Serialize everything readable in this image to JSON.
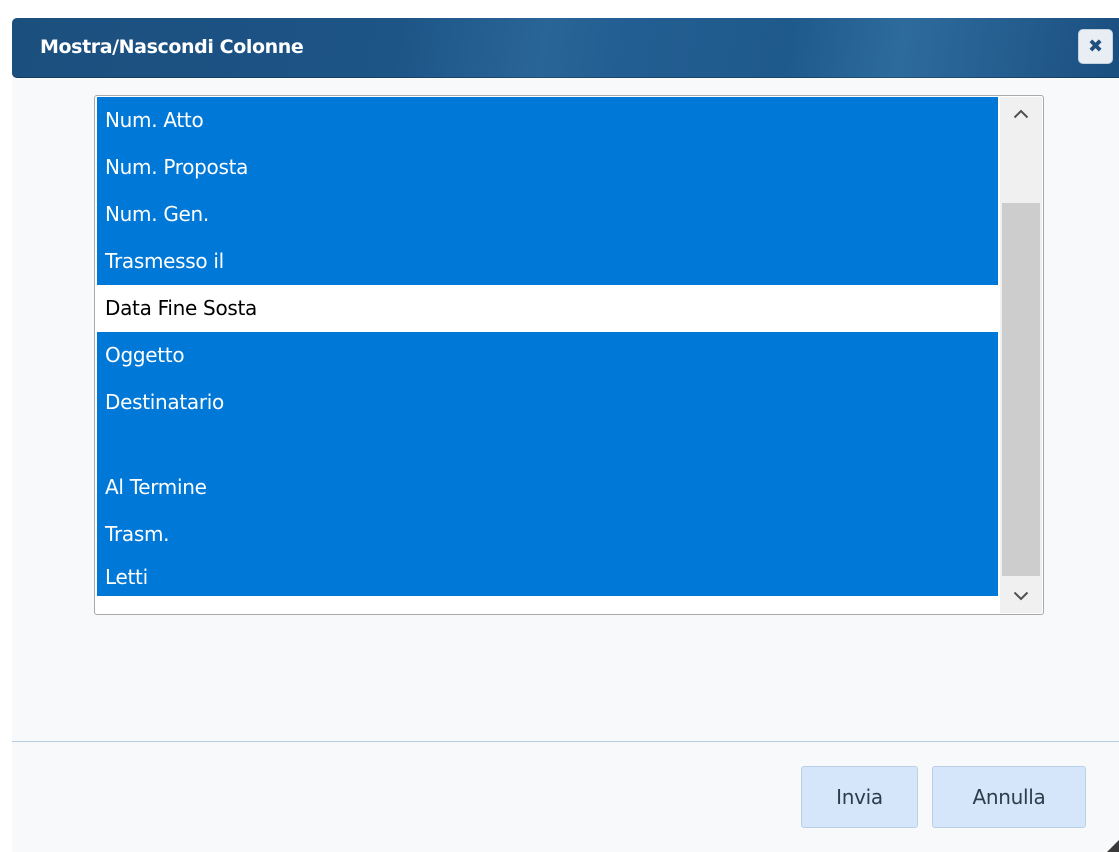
{
  "dialog": {
    "title": "Mostra/Nascondi Colonne",
    "close_icon": "close-x-icon"
  },
  "columns": {
    "items": [
      {
        "label": "Num. Atto",
        "selected": true
      },
      {
        "label": "Num. Proposta",
        "selected": true
      },
      {
        "label": "Num. Gen.",
        "selected": true
      },
      {
        "label": "Trasmesso il",
        "selected": true
      },
      {
        "label": "Data Fine Sosta",
        "selected": false
      },
      {
        "label": "Oggetto",
        "selected": true
      },
      {
        "label": "Destinatario",
        "selected": true
      },
      {
        "label": "",
        "selected": true
      },
      {
        "label": "Al Termine",
        "selected": true
      },
      {
        "label": "Trasm.",
        "selected": true
      },
      {
        "label": "Letti",
        "selected": true
      }
    ]
  },
  "scrollbar": {
    "up_icon": "chevron-up-icon",
    "down_icon": "chevron-down-icon"
  },
  "footer": {
    "submit_label": "Invia",
    "cancel_label": "Annulla"
  },
  "colors": {
    "selection": "#0078d7",
    "titlebar": "#1d5587",
    "button_bg": "#d6e6fa"
  }
}
